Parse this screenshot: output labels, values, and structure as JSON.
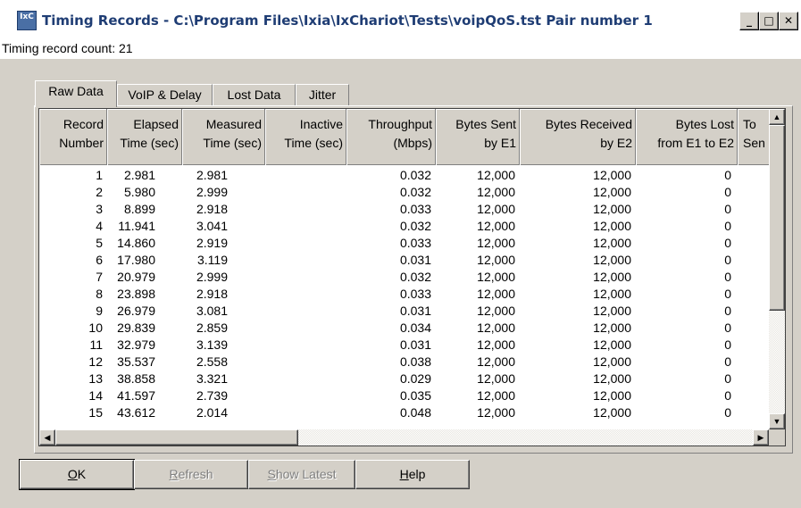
{
  "window": {
    "icon_text": "IxC",
    "title": "Timing Records - C:\\Program Files\\Ixia\\IxChariot\\Tests\\voipQoS.tst  Pair number 1",
    "minimize": "_",
    "maximize": "□",
    "close": "✕"
  },
  "record_count_label": "Timing record count: 21",
  "tabs": [
    "Raw Data",
    "VoIP & Delay",
    "Lost Data",
    "Jitter"
  ],
  "table": {
    "columns": [
      "Record\nNumber",
      "Elapsed\nTime (sec)",
      "Measured\nTime (sec)",
      "Inactive\nTime (sec)",
      "Throughput\n(Mbps)",
      "Bytes Sent\nby E1",
      "Bytes Received\nby E2",
      "Bytes Lost\nfrom E1 to E2",
      "To\nSen"
    ],
    "rows": [
      [
        "1",
        "2.981",
        "2.981",
        "",
        "0.032",
        "12,000",
        "12,000",
        "0"
      ],
      [
        "2",
        "5.980",
        "2.999",
        "",
        "0.032",
        "12,000",
        "12,000",
        "0"
      ],
      [
        "3",
        "8.899",
        "2.918",
        "",
        "0.033",
        "12,000",
        "12,000",
        "0"
      ],
      [
        "4",
        "11.941",
        "3.041",
        "",
        "0.032",
        "12,000",
        "12,000",
        "0"
      ],
      [
        "5",
        "14.860",
        "2.919",
        "",
        "0.033",
        "12,000",
        "12,000",
        "0"
      ],
      [
        "6",
        "17.980",
        "3.119",
        "",
        "0.031",
        "12,000",
        "12,000",
        "0"
      ],
      [
        "7",
        "20.979",
        "2.999",
        "",
        "0.032",
        "12,000",
        "12,000",
        "0"
      ],
      [
        "8",
        "23.898",
        "2.918",
        "",
        "0.033",
        "12,000",
        "12,000",
        "0"
      ],
      [
        "9",
        "26.979",
        "3.081",
        "",
        "0.031",
        "12,000",
        "12,000",
        "0"
      ],
      [
        "10",
        "29.839",
        "2.859",
        "",
        "0.034",
        "12,000",
        "12,000",
        "0"
      ],
      [
        "11",
        "32.979",
        "3.139",
        "",
        "0.031",
        "12,000",
        "12,000",
        "0"
      ],
      [
        "12",
        "35.537",
        "2.558",
        "",
        "0.038",
        "12,000",
        "12,000",
        "0"
      ],
      [
        "13",
        "38.858",
        "3.321",
        "",
        "0.029",
        "12,000",
        "12,000",
        "0"
      ],
      [
        "14",
        "41.597",
        "2.739",
        "",
        "0.035",
        "12,000",
        "12,000",
        "0"
      ],
      [
        "15",
        "43.612",
        "2.014",
        "",
        "0.048",
        "12,000",
        "12,000",
        "0"
      ]
    ]
  },
  "scroll": {
    "up": "▲",
    "down": "▼",
    "left": "◀",
    "right": "▶"
  },
  "buttons": {
    "ok": {
      "mnemonic": "O",
      "rest": "K"
    },
    "refresh": {
      "mnemonic": "R",
      "rest": "efresh"
    },
    "show_latest": {
      "mnemonic": "S",
      "rest": "how Latest"
    },
    "help": {
      "mnemonic": "H",
      "rest": "elp"
    }
  }
}
